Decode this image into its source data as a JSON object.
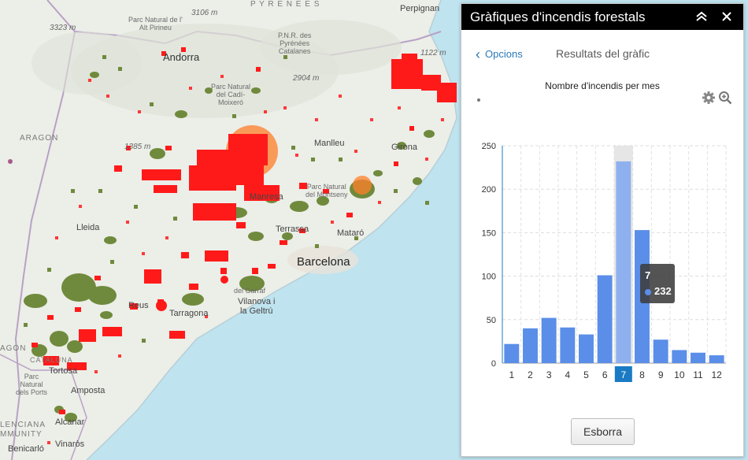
{
  "map": {
    "colors": {
      "land": "#eceee8",
      "sea": "#bfe3ef",
      "fire": "#ff1a1a",
      "burn": "#6f8a3c",
      "border": "#b8a2c4"
    },
    "labels": {
      "peak_3106": "3106 m",
      "pyrenees": "P Y R E N E E S",
      "perpignan": "Perpignan",
      "peak_3323": "3323 m",
      "parc_alt_pirineu": "Parc Natural de l'\nAlt Pirineu",
      "pnr_pyrenees": "P.N.R. des\nPyrénées\nCatalanes",
      "peak_1122": "1122 m",
      "andorra": "Andorra",
      "peak_2904": "2904 m",
      "parc_cadi": "Parc Natural\ndel Cadí-\nMoixeró",
      "aragon": "ARAGON",
      "peak_1385": "1385 m",
      "manlleu": "Manlleu",
      "girona": "Girona",
      "parc_montseny": "Parc Natural\ndel Montseny",
      "manresa": "Manresa",
      "lleida": "Lleida",
      "terrassa": "Terrassa",
      "mataro": "Mataró",
      "barcelona": "Barcelona",
      "vilanova": "Vilanova i\nla Geltrú",
      "reus": "Reus",
      "tarragona": "Tarragona",
      "aragon_left": "AGON",
      "parc_ports": "Parc\nNatural\ndels Ports",
      "cataluna": "CATALUNA",
      "tortosa": "Tortosa",
      "amposta": "Amposta",
      "alcanar": "Alcanar",
      "valenciana": "LENCIANA\nMMUNITY",
      "benicarlo": "Benicarló",
      "vinaros": "Vinaròs",
      "penedes": "del Garraf"
    }
  },
  "panel": {
    "title": "Gràfiques d'incendis forestals",
    "collapse_icon": "double-chevron-up-icon",
    "close_icon": "close-icon",
    "back_label": "Opcions",
    "results_label": "Resultats del gràfic",
    "clear_label": "Esborra"
  },
  "chart_data": {
    "type": "bar",
    "title": "Nombre d'incendis per mes",
    "categories": [
      "1",
      "2",
      "3",
      "4",
      "5",
      "6",
      "7",
      "8",
      "9",
      "10",
      "11",
      "12"
    ],
    "values": [
      22,
      40,
      52,
      41,
      33,
      101,
      232,
      153,
      27,
      15,
      12,
      9
    ],
    "ylim": [
      0,
      250
    ],
    "yticks": [
      "0",
      "50",
      "100",
      "150",
      "200",
      "250"
    ],
    "grid": true,
    "selected_category": "7",
    "color": "#5a8ee8",
    "selected_color": "#8fb0ee",
    "axis_highlight_color": "#1a7bc4",
    "tooltip": {
      "label": "7",
      "value": "232"
    }
  }
}
